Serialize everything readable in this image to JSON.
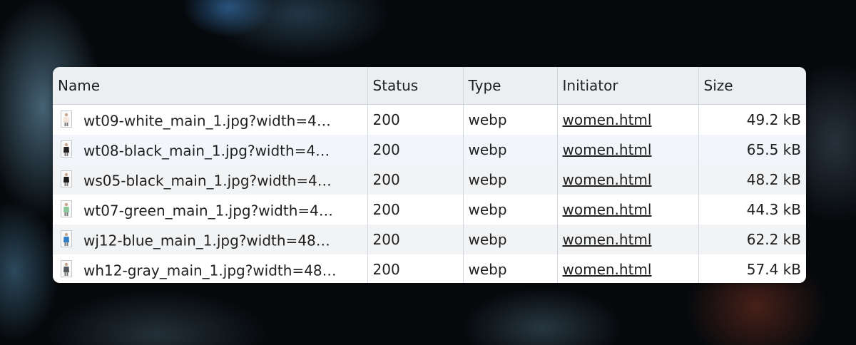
{
  "columns": {
    "name": "Name",
    "status": "Status",
    "type": "Type",
    "initiator": "Initiator",
    "size": "Size"
  },
  "rows": [
    {
      "name": "wt09-white_main_1.jpg?width=4…",
      "status": "200",
      "type": "webp",
      "initiator": "women.html",
      "size": "49.2 kB",
      "thumb_color": "#f3e3d9"
    },
    {
      "name": "wt08-black_main_1.jpg?width=4…",
      "status": "200",
      "type": "webp",
      "initiator": "women.html",
      "size": "65.5 kB",
      "thumb_color": "#222222"
    },
    {
      "name": "ws05-black_main_1.jpg?width=4…",
      "status": "200",
      "type": "webp",
      "initiator": "women.html",
      "size": "48.2 kB",
      "thumb_color": "#1c1c1c"
    },
    {
      "name": "wt07-green_main_1.jpg?width=4…",
      "status": "200",
      "type": "webp",
      "initiator": "women.html",
      "size": "44.3 kB",
      "thumb_color": "#8cc79a"
    },
    {
      "name": "wj12-blue_main_1.jpg?width=48…",
      "status": "200",
      "type": "webp",
      "initiator": "women.html",
      "size": "62.2 kB",
      "thumb_color": "#2f7fc9"
    },
    {
      "name": "wh12-gray_main_1.jpg?width=48…",
      "status": "200",
      "type": "webp",
      "initiator": "women.html",
      "size": "57.4 kB",
      "thumb_color": "#555a60"
    }
  ]
}
